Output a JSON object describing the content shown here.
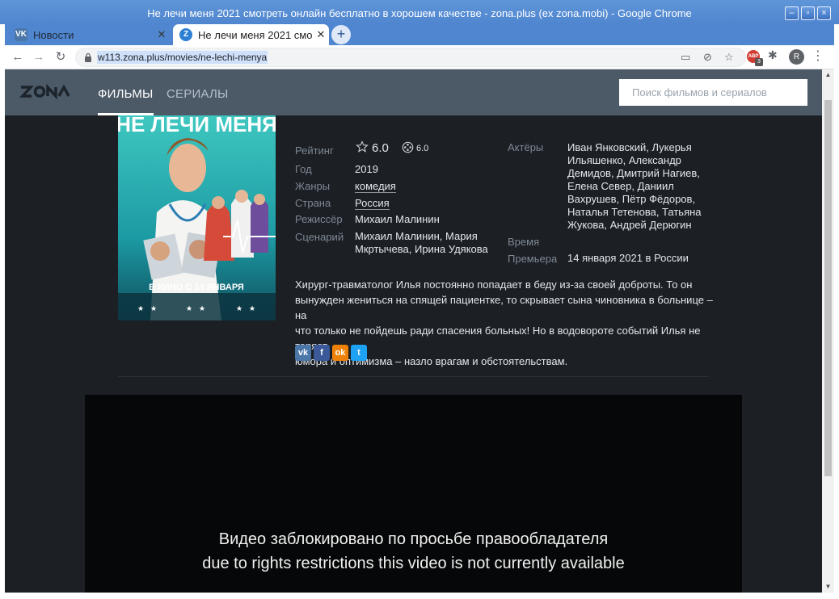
{
  "window": {
    "title": "Не лечи меня 2021 смотреть онлайн бесплатно в хорошем качестве - zona.plus (ex zona.mobi) - Google Chrome",
    "controls": {
      "minimize": "–",
      "maximize": "▫",
      "close": "×"
    }
  },
  "tabs": [
    {
      "label": "Новости",
      "favicon_text": "VK",
      "favicon_color": "#4a76a8",
      "active": false
    },
    {
      "label": "Не лечи меня 2021 смо",
      "favicon_text": "Z",
      "favicon_color": "#2d7fd3",
      "active": true
    }
  ],
  "new_tab_label": "+",
  "toolbar": {
    "url": "w113.zona.plus/movies/ne-lechi-menya",
    "abp_badge": "ABP",
    "abp_count": "3",
    "profile_initial": "R"
  },
  "site": {
    "logo": "ZONA",
    "nav": [
      "ФИЛЬМЫ",
      "СЕРИАЛЫ"
    ],
    "search_placeholder": "Поиск фильмов и сериалов"
  },
  "poster": {
    "title": "НЕ ЛЕЧИ МЕНЯ",
    "caption": "В КИНО С 14 ЯНВАРЯ"
  },
  "details": {
    "rating_label": "Рейтинг",
    "rating": "6.0",
    "imdb_rating": "6.0",
    "year_label": "Год",
    "year": "2019",
    "genres_label": "Жанры",
    "genre": "комедия",
    "country_label": "Страна",
    "country": "Россия",
    "director_label": "Режиссёр",
    "director": "Михаил Малинин",
    "writers_label": "Сценарий",
    "writers_line1": "Михаил Малинин, Мария",
    "writers_line2": "Мкртычева, Ирина Удякова",
    "actors_label": "Актёры",
    "actors_lines": [
      "Иван Янковский, Лукерья",
      "Ильяшенко, Александр",
      "Демидов, Дмитрий Нагиев,",
      "Елена Север, Даниил",
      "Вахрушев, Пётр Фёдоров,",
      "Наталья Тетенова, Татьяна",
      "Жукова, Андрей Дерюгин"
    ],
    "time_label": "Время",
    "premiere_label": "Премьера",
    "premiere": "14 января 2021 в России"
  },
  "description_lines": [
    "Хирург-травматолог Илья постоянно попадает в беду из-за своей доброты. То он",
    "вынужден жениться на спящей пациентке, то скрывает сына чиновника в больнице – на",
    "что только не пойдешь ради спасения больных! Но в водовороте событий Илья не теряет",
    "юмора и оптимизма – назло врагам и обстоятельствам."
  ],
  "share": [
    {
      "name": "vk",
      "text": "vk",
      "color": "#4a76a8"
    },
    {
      "name": "facebook",
      "text": "f",
      "color": "#3b5998"
    },
    {
      "name": "odnoklassniki",
      "text": "ok",
      "color": "#ee8208"
    },
    {
      "name": "twitter",
      "text": "t",
      "color": "#1da1f2"
    }
  ],
  "player": {
    "message_ru": "Видео заблокировано по просьбе правообладателя",
    "message_en": "due to rights restrictions this video is not currently available"
  }
}
